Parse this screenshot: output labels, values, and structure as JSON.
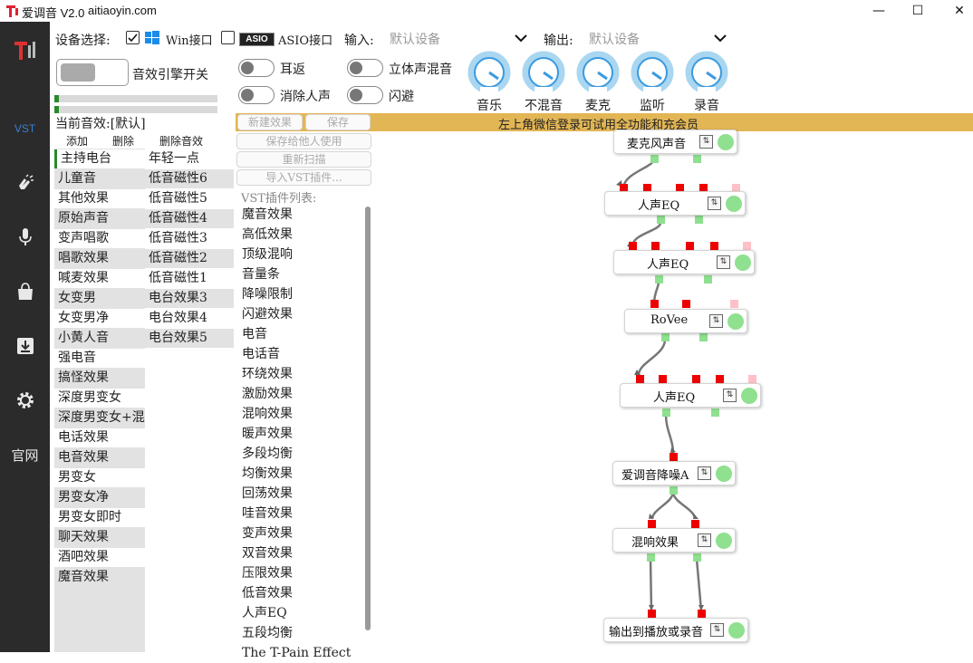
{
  "window": {
    "title": "爱调音 V2.0",
    "domain": "aitiaoyin.com",
    "minimize": "—",
    "maximize": "☐",
    "close": "✕"
  },
  "sidebar": {
    "vst": "VST",
    "website": "官网"
  },
  "device": {
    "label": "设备选择:",
    "win_label": "Win接口",
    "asio_badge": "ASIO",
    "asio_label": "ASIO接口",
    "input_label": "输入:",
    "input_value": "默认设备",
    "output_label": "输出:",
    "output_value": "默认设备"
  },
  "engine": {
    "label": "音效引擎开关"
  },
  "toggles": {
    "ear_return": "耳返",
    "stereo_mix": "立体声混音",
    "remove_vocal": "消除人声",
    "ducking": "闪避"
  },
  "knobs": [
    "音乐",
    "不混音",
    "麦克",
    "监听",
    "录音"
  ],
  "current_effect": "当前音效:[默认]",
  "effect_actions": {
    "add": "添加",
    "delete": "删除",
    "delete_effect": "删除音效"
  },
  "effects_col1": [
    "主持电台",
    "儿童音",
    "其他效果",
    "原始声音",
    "变声唱歌",
    "唱歌效果",
    "喊麦效果",
    "女变男",
    "女变男净",
    "小黄人音",
    "强电音",
    "搞怪效果",
    "深度男变女",
    "深度男变女+混响",
    "电话效果",
    "电音效果",
    "男变女",
    "男变女净",
    "男变女即时",
    "聊天效果",
    "酒吧效果",
    "魔音效果"
  ],
  "effects_col2": [
    "年轻一点",
    "低音磁性6",
    "低音磁性5",
    "低音磁性4",
    "低音磁性3",
    "低音磁性2",
    "低音磁性1",
    "电台效果3",
    "电台效果4",
    "电台效果5"
  ],
  "vst_buttons": {
    "new_effect": "新建效果",
    "save": "保存",
    "save_for_others": "保存给他人使用",
    "rescan": "重新扫描",
    "import_vst": "导入VST插件..."
  },
  "banner": "左上角微信登录可试用全功能和充会员",
  "vst_list_title": "VST插件列表:",
  "vst_plugins": [
    "魔音效果",
    "高低效果",
    "顶级混响",
    "音量条",
    "降噪限制",
    "闪避效果",
    "电音",
    "电话音",
    "环绕效果",
    "激励效果",
    "混响效果",
    "暖声效果",
    "多段均衡",
    "均衡效果",
    "回荡效果",
    "哇音效果",
    "变声效果",
    "双音效果",
    "压限效果",
    "低音效果",
    "人声EQ",
    "五段均衡",
    "The T-Pain Effect"
  ],
  "graph_nodes": [
    "麦克风声音",
    "人声EQ",
    "人声EQ",
    "RoVee",
    "人声EQ",
    "爱调音降噪A",
    "混响效果",
    "输出到播放或录音"
  ],
  "colors": {
    "banner": "#e2b655",
    "sidebar": "#2b2b2b",
    "pin_red": "#ee0000",
    "pin_green": "#8fe08f"
  }
}
